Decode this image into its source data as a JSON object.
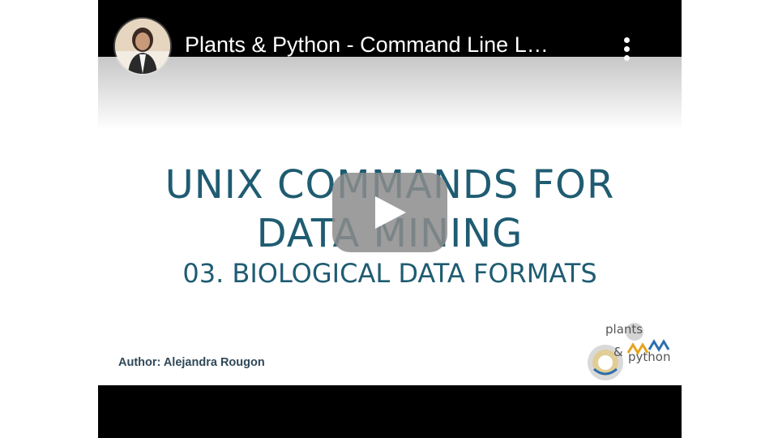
{
  "header": {
    "title": "Plants & Python - Command Line L…",
    "menu_icon": "more-vert-icon",
    "avatar_icon": "channel-avatar"
  },
  "slide": {
    "title_line1": "UNIX COMMANDS FOR",
    "title_line2": "DATA MINING",
    "subtitle": "03. BIOLOGICAL DATA FORMATS",
    "author": "Author: Alejandra Rougon",
    "logo": {
      "word1": "plants",
      "word2": "&",
      "word3": "python"
    }
  },
  "player": {
    "play_icon": "play-icon"
  },
  "colors": {
    "title_color": "#1f5c72",
    "header_bg": "#000000",
    "play_button": "#8c8c8c"
  }
}
